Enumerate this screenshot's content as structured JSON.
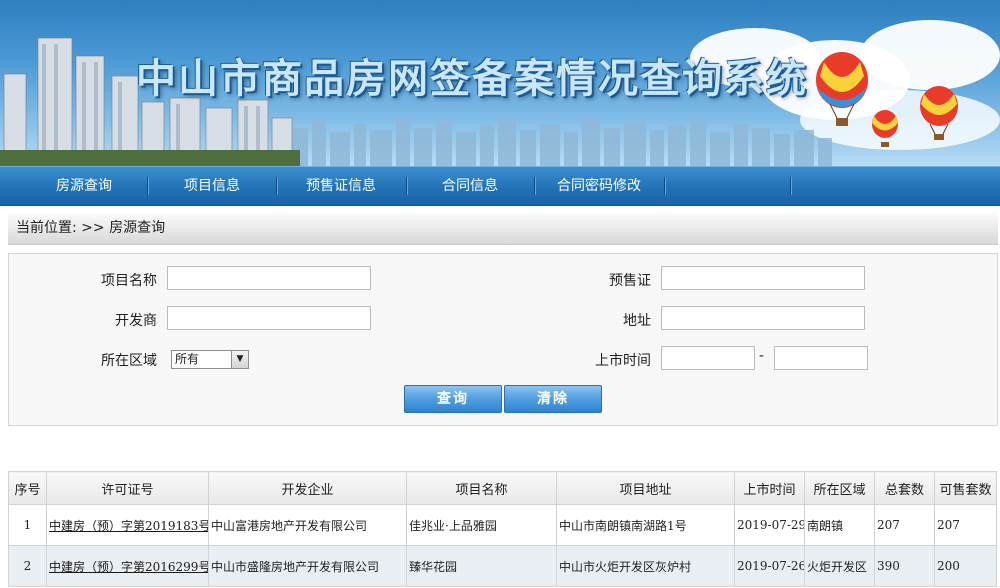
{
  "header": {
    "title": "中山市商品房网签备案情况查询系统"
  },
  "nav": {
    "items": [
      "房源查询",
      "项目信息",
      "预售证信息",
      "合同信息",
      "合同密码修改"
    ]
  },
  "breadcrumb": {
    "text": "当前位置: >> 房源查询"
  },
  "search": {
    "project_name_label": "项目名称",
    "project_name_value": "",
    "presale_label": "预售证",
    "presale_value": "",
    "developer_label": "开发商",
    "developer_value": "",
    "address_label": "地址",
    "address_value": "",
    "region_label": "所在区域",
    "region_selected": "所有",
    "listing_time_label": "上市时间",
    "listing_time_from": "",
    "listing_time_to": "",
    "range_separator": "-",
    "query_button": "查询",
    "clear_button": "清除"
  },
  "table": {
    "headers": [
      "序号",
      "许可证号",
      "开发企业",
      "项目名称",
      "项目地址",
      "上市时间",
      "所在区域",
      "总套数",
      "可售套数"
    ],
    "rows": [
      [
        "1",
        "中建房（预）字第2019183号",
        "中山富港房地产开发有限公司",
        "佳兆业·上品雅园",
        "中山市南朗镇南湖路1号",
        "2019-07-29",
        "南朗镇",
        "207",
        "207"
      ],
      [
        "2",
        "中建房（预）字第2016299号",
        "中山市盛隆房地产开发有限公司",
        "臻华花园",
        "中山市火炬开发区灰炉村",
        "2019-07-26",
        "火炬开发区",
        "390",
        "200"
      ]
    ]
  },
  "colors": {
    "nav_bg": "#2172b6",
    "button_bg": "#4f9ee0",
    "alt_row_bg": "#e9eef3"
  }
}
